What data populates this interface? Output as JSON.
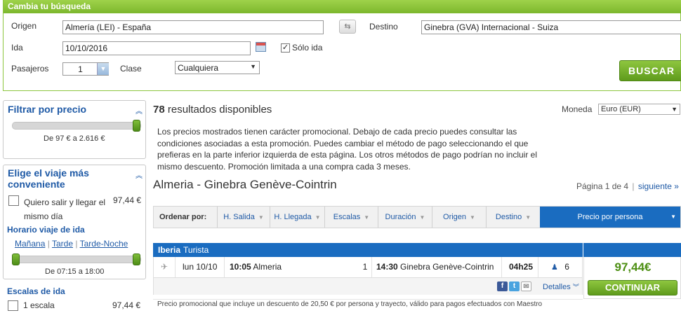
{
  "search": {
    "header": "Cambia tu búsqueda",
    "origin_label": "Origen",
    "origin_value": "Almería (LEI)  - España",
    "destination_label": "Destino",
    "destination_value": "Ginebra (GVA) Internacional - Suiza",
    "date_label": "Ida",
    "date_value": "10/10/2016",
    "oneway_label": "Sólo ida",
    "passengers_label": "Pasajeros",
    "passengers_value": "1",
    "class_label": "Clase",
    "class_value": "Cualquiera",
    "submit_label": "BUSCAR"
  },
  "filters": {
    "price": {
      "title": "Filtrar por precio",
      "range_text": "De 97 € a 2.616 €",
      "min_fraction": 0.0,
      "max_fraction": 1.0
    },
    "best": {
      "title_line1": "Elige el viaje más",
      "title_line2": "conveniente",
      "option_line1": "Quiero salir y llegar el",
      "option_line2": "mismo día",
      "option_price": "97,44 €",
      "schedule_title": "Horario viaje de ida",
      "schedule_options": [
        "Mañana",
        "Tarde",
        "Tarde-Noche"
      ],
      "schedule_range_text": "De 07:15 a 18:00"
    },
    "stops": {
      "title": "Escalas de ida",
      "option_label": "1 escala",
      "option_price": "97,44 €"
    }
  },
  "results": {
    "count": "78",
    "count_suffix": "resultados disponibles",
    "currency_label": "Moneda",
    "currency_value": "Euro (EUR)",
    "promo_text": "Los precios mostrados tienen carácter promocional. Debajo de cada precio puedes consultar las condiciones asociadas a esta promoción. Puedes cambiar el método de pago seleccionando el que prefieras en la parte inferior izquierda de esta página. Los otros métodos de pago podrían no incluir el mismo descuento. Promoción limitada a una compra cada 3 meses.",
    "route_title": "Almeria - Ginebra Genève-Cointrin",
    "page_text": "Página 1 de 4",
    "next_label": "siguiente »"
  },
  "sort": {
    "label": "Ordenar por:",
    "items": [
      "H. Salida",
      "H. Llegada",
      "Escalas",
      "Duración",
      "Origen",
      "Destino",
      "Precio por persona"
    ]
  },
  "flight": {
    "airline": "Iberia",
    "fare": "Turista",
    "date": "lun 10/10",
    "dep_time": "10:05",
    "dep_city": "Almeria",
    "stops": "1",
    "arr_time": "14:30",
    "arr_city": "Ginebra Genève-Cointrin",
    "duration": "04h25",
    "seats": "6",
    "details_label": "Detalles",
    "price": "97,44€",
    "continue_label": "CONTINUAR",
    "promo_note": "Precio promocional que incluye un descuento de 20,50 € por persona y trayecto, válido para pagos efectuados con Maestro"
  },
  "colors": {
    "green": "#7cb72d",
    "blue": "#1a6cc0",
    "price_green": "#4c8e12"
  }
}
